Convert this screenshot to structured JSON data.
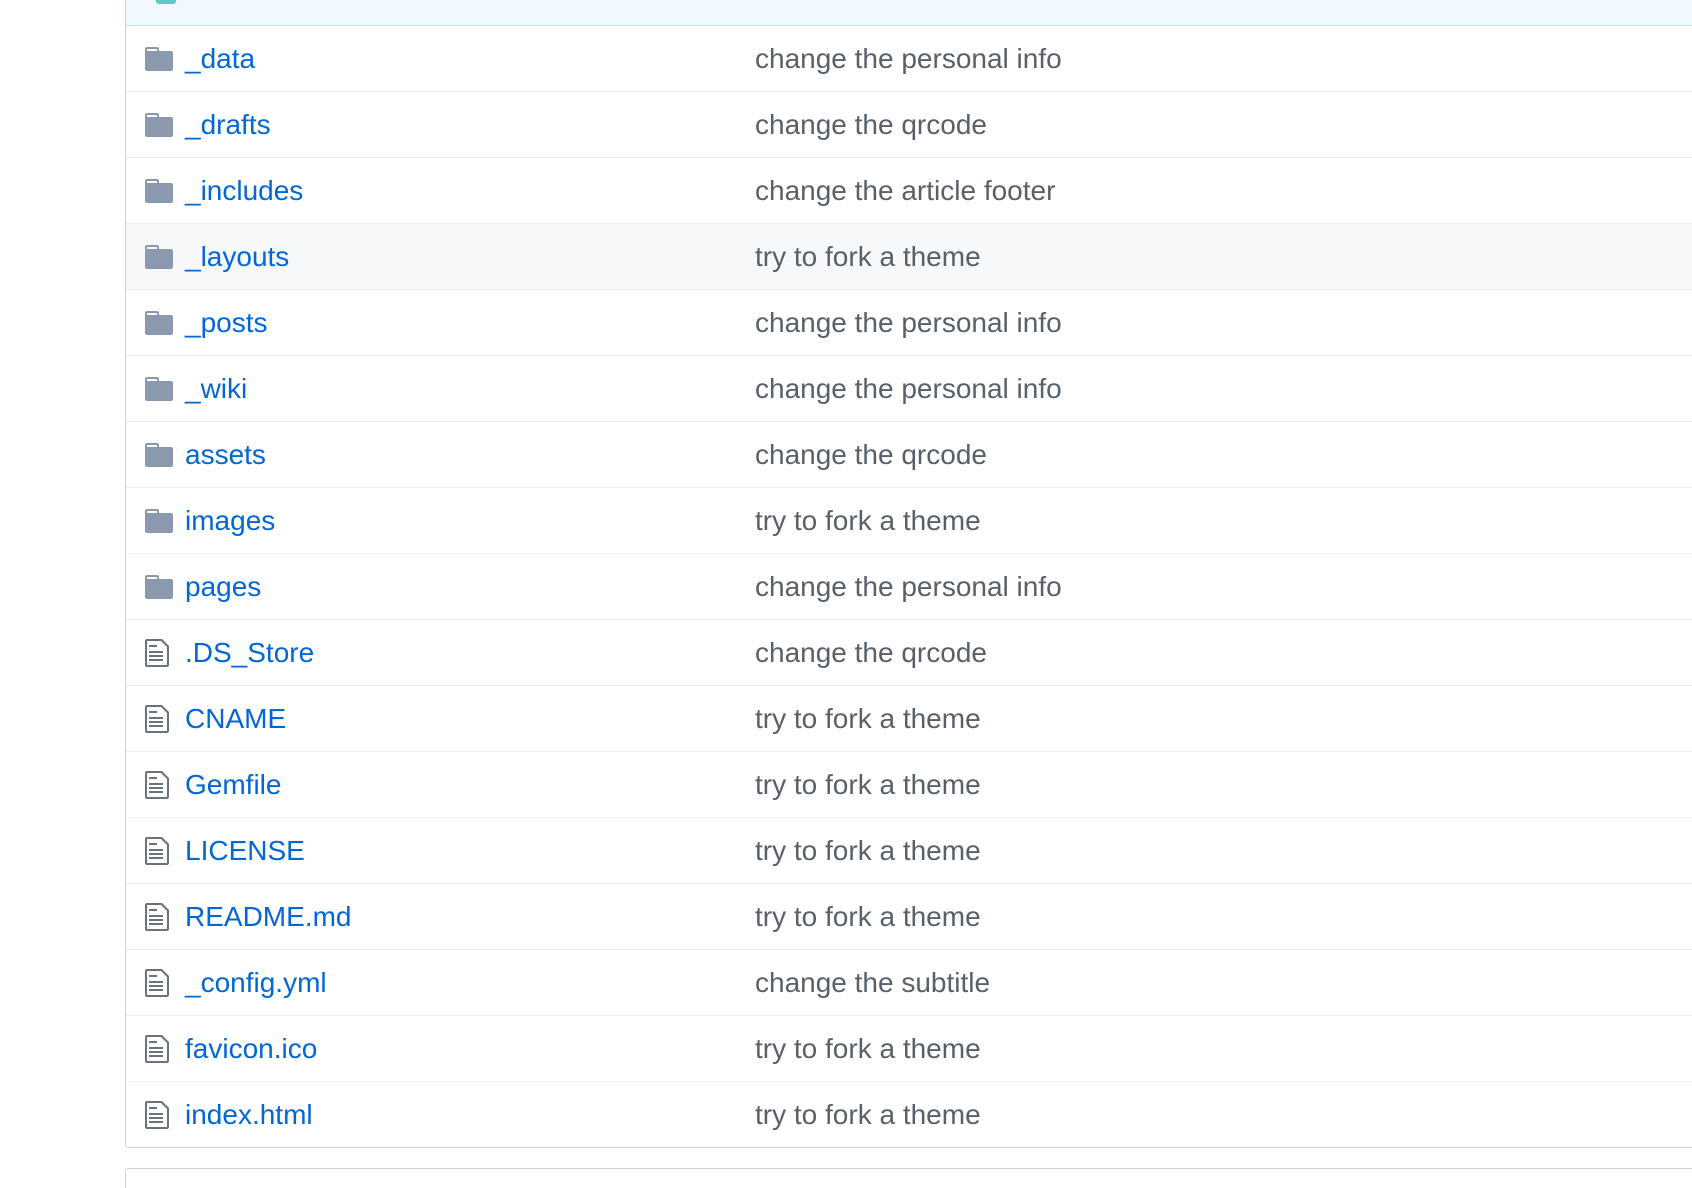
{
  "colors": {
    "link": "#0366d6",
    "message": "#586069",
    "folder_icon": "#79b8ff",
    "file_icon": "#6a737d",
    "hover_row": "#f6f8fa",
    "commit_bar": "#f1f8ff"
  },
  "files": [
    {
      "icon": "folder-icon",
      "name": "_data",
      "message": "change the personal info"
    },
    {
      "icon": "folder-icon",
      "name": "_drafts",
      "message": "change the qrcode"
    },
    {
      "icon": "folder-icon",
      "name": "_includes",
      "message": "change the article footer"
    },
    {
      "icon": "folder-icon",
      "name": "_layouts",
      "message": "try to fork a theme"
    },
    {
      "icon": "folder-icon",
      "name": "_posts",
      "message": "change the personal info"
    },
    {
      "icon": "folder-icon",
      "name": "_wiki",
      "message": "change the personal info"
    },
    {
      "icon": "folder-icon",
      "name": "assets",
      "message": "change the qrcode"
    },
    {
      "icon": "folder-icon",
      "name": "images",
      "message": "try to fork a theme"
    },
    {
      "icon": "folder-icon",
      "name": "pages",
      "message": "change the personal info"
    },
    {
      "icon": "file-icon",
      "name": ".DS_Store",
      "message": "change the qrcode"
    },
    {
      "icon": "file-icon",
      "name": "CNAME",
      "message": "try to fork a theme"
    },
    {
      "icon": "file-icon",
      "name": "Gemfile",
      "message": "try to fork a theme"
    },
    {
      "icon": "file-icon",
      "name": "LICENSE",
      "message": "try to fork a theme"
    },
    {
      "icon": "file-icon",
      "name": "README.md",
      "message": "try to fork a theme"
    },
    {
      "icon": "file-icon",
      "name": "_config.yml",
      "message": "change the subtitle"
    },
    {
      "icon": "file-icon",
      "name": "favicon.ico",
      "message": "try to fork a theme"
    },
    {
      "icon": "file-icon",
      "name": "index.html",
      "message": "try to fork a theme"
    }
  ]
}
